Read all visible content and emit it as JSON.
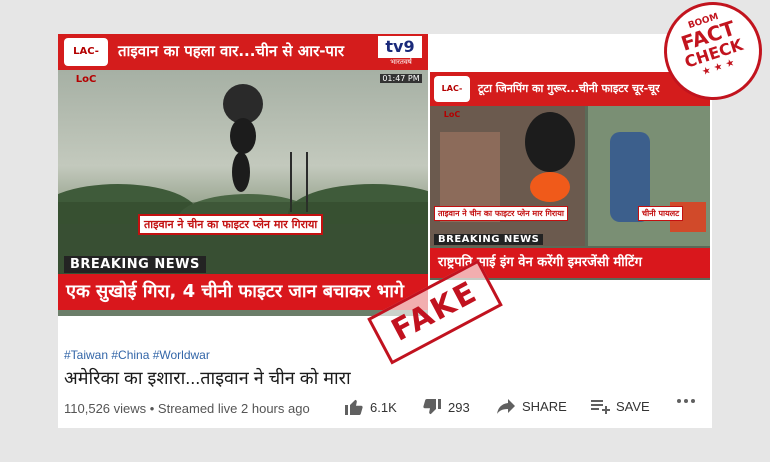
{
  "badge": {
    "line1": "BOOM",
    "line2": "FACT",
    "line3": "CHECK"
  },
  "stamp": {
    "text": "FAKE"
  },
  "thumb_main": {
    "logo": "LAC-LoC",
    "banner": "ताइवान का पहला वार...चीन से आर-पार",
    "channel": "tv9",
    "channel_sub": "भारतवर्ष",
    "time": "01:47 PM",
    "caption": "ताइवान ने चीन का फाइटर प्लेन मार गिराया",
    "breaking": "BREAKING NEWS",
    "headline": "एक सुखोई गिरा, 4 चीनी फाइटर जान बचाकर भागे"
  },
  "thumb_second": {
    "logo": "LAC-LoC",
    "banner": "टूटा जिनपिंग का गुरूर...चीनी फाइटर चूर-चूर",
    "caption": "ताइवान ने चीन का फाइटर प्लेन मार गिराया",
    "label_pilot": "चीनी पायलट",
    "breaking": "BREAKING NEWS",
    "headline": "राष्ट्रपति साई इंग वेन करेंगी इमरजेंसी मीटिंग"
  },
  "video": {
    "tags": "#Taiwan #China #Worldwar",
    "title": "अमेरिका का इशारा...ताइवान ने चीन को मारा",
    "views": "110,526 views • Streamed live 2 hours ago",
    "likes": "6.1K",
    "dislikes": "293",
    "share_label": "SHARE",
    "save_label": "SAVE"
  },
  "colors": {
    "news_red": "#d41c1c",
    "link_blue": "#3366a8",
    "stamp_red": "#c1121f"
  }
}
